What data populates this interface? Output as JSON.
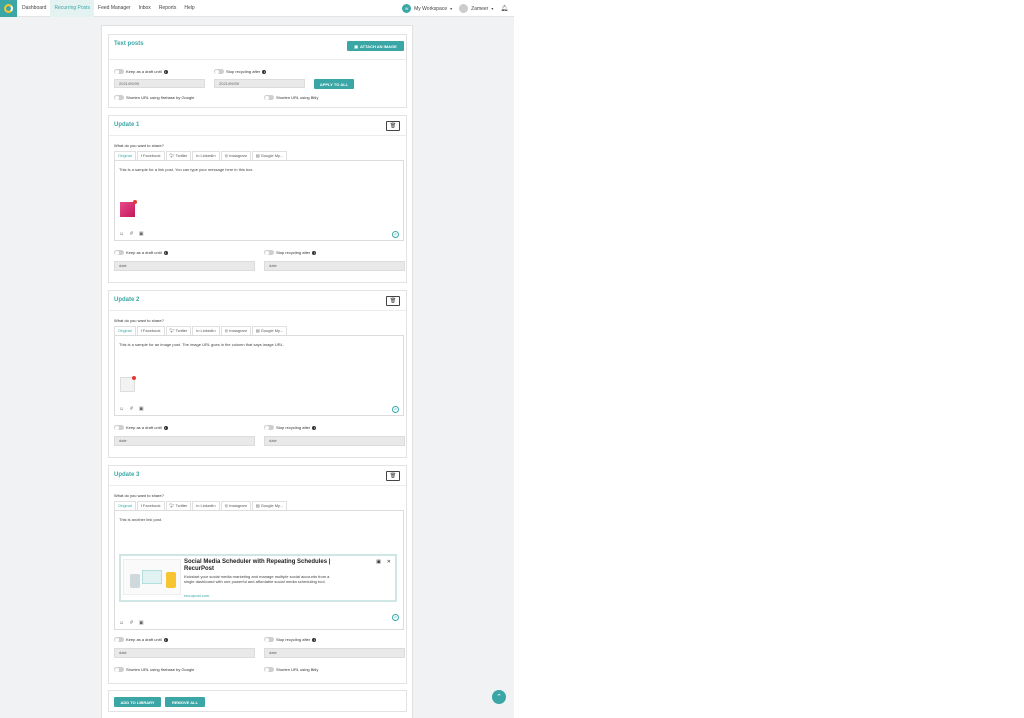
{
  "nav": {
    "items": [
      "Dashboard",
      "Recurring Posts",
      "Feed Manager",
      "Inbox",
      "Reports",
      "Help"
    ],
    "active": 1
  },
  "header": {
    "workspace_initials": "W",
    "workspace": "My Workspace",
    "user": "Zameer"
  },
  "text_posts": {
    "title": "Text posts",
    "attach_label": "ATTACH AN IMAGE",
    "draft_label": "Keep as a draft until",
    "stop_label": "Stop recycling after",
    "draft_date": "2021/09/09",
    "stop_date": "2021/09/09",
    "apply_label": "APPLY TO ALL",
    "firebase_label": "Shorten URL using firebase by Google",
    "bitly_label": "Shorten URL using Bitly"
  },
  "common": {
    "question": "What do you want to share?",
    "tabs": [
      "Original",
      "Facebook",
      "Twitter",
      "LinkedIn",
      "Instagram",
      "Google My..."
    ],
    "draft_label": "Keep as a draft until",
    "stop_label": "Stop recycling after",
    "date_placeholder": "date",
    "firebase_label": "Shorten URL using firebase by Google",
    "bitly_label": "Shorten URL using Bitly"
  },
  "updates": [
    {
      "title": "Update 1",
      "message": "This is a sample for a link post. You can type your message here in this box."
    },
    {
      "title": "Update 2",
      "message": "This is a sample for an image post. The image URL goes in the column that says image URL."
    },
    {
      "title": "Update 3",
      "message": "This is another link post."
    }
  ],
  "link_preview": {
    "title": "Social Media Scheduler with Repeating Schedules | RecurPost",
    "description": "Kickstart your social media marketing and manage multiple social accounts from a single dashboard with one powerful and affordable social media scheduling tool.",
    "url": "recurpost.com"
  },
  "footer": {
    "add_label": "ADD TO LIBRARY",
    "remove_label": "REMOVE ALL"
  },
  "colors": {
    "accent": "#3aa7a6",
    "badge": "#e53935"
  }
}
